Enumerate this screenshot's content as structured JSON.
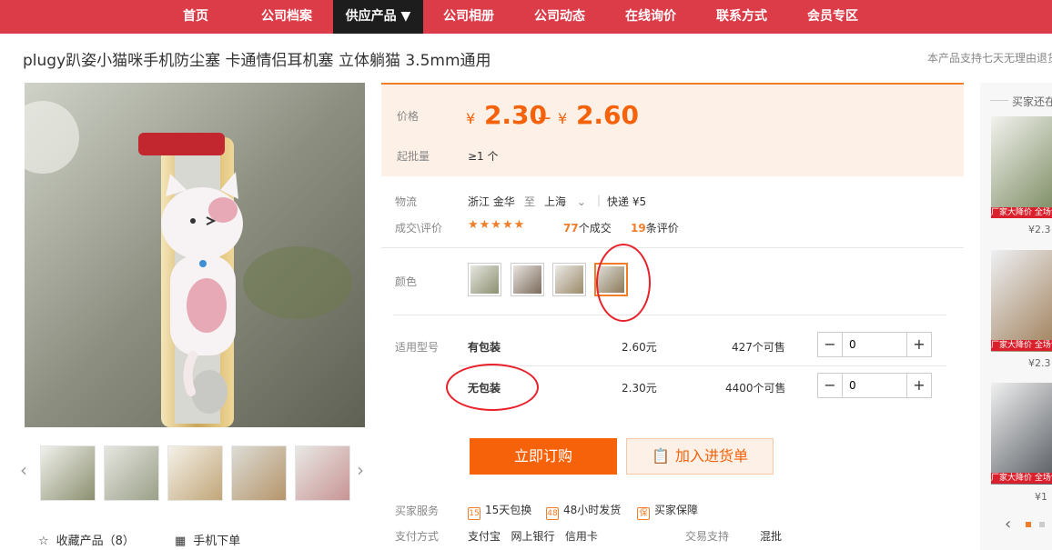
{
  "nav": {
    "items": [
      {
        "label": "首页"
      },
      {
        "label": "公司档案"
      },
      {
        "label": "供应产品 ▼"
      },
      {
        "label": "公司相册"
      },
      {
        "label": "公司动态"
      },
      {
        "label": "在线询价"
      },
      {
        "label": "联系方式"
      },
      {
        "label": "会员专区"
      }
    ],
    "active_index": 2
  },
  "product": {
    "title": "plugy趴姿小猫咪手机防尘塞 卡通情侣耳机塞 立体躺猫 3.5mm通用",
    "return_notice": "本产品支持七天无理由退货"
  },
  "price": {
    "label": "价格",
    "currency": "¥",
    "low": "2.30",
    "separator": "--",
    "high": "2.60",
    "moq_label": "起批量",
    "moq_value": "≥1 个"
  },
  "logistics": {
    "label": "物流",
    "from": "浙江 金华",
    "to_word": "至",
    "to": "上海",
    "express": "快递 ¥5"
  },
  "rating": {
    "label": "成交\\评价",
    "stars": "★★★★★",
    "deals_count": "77",
    "deals_suffix": "个成交",
    "reviews_count": "19",
    "reviews_suffix": "条评价"
  },
  "color": {
    "label": "颜色",
    "selected_index": 3
  },
  "models": {
    "label": "适用型号",
    "rows": [
      {
        "name": "有包装",
        "price": "2.60元",
        "stock": "427个可售",
        "qty": "0"
      },
      {
        "name": "无包装",
        "price": "2.30元",
        "stock": "4400个可售",
        "qty": "0"
      }
    ]
  },
  "actions": {
    "buy": "立即订购",
    "cart": "加入进货单"
  },
  "services": {
    "label": "买家服务",
    "items": [
      "15天包换",
      "48小时发货",
      "买家保障"
    ],
    "icons": [
      "15",
      "48",
      "保"
    ]
  },
  "payment": {
    "label": "支付方式",
    "methods": "支付宝   网上银行   信用卡",
    "trade_label": "交易支持",
    "trade_value": "混批"
  },
  "sidebar": {
    "favorite": "收藏产品（8）",
    "mobile_order": "手机下单"
  },
  "right_panel": {
    "title": "买家还在看",
    "badge": "厂家大降价 全场包邮",
    "prices": [
      "¥2.3",
      "¥2.3",
      "¥1"
    ]
  },
  "colors": {
    "nav_bg": "#dc3b48",
    "accent": "#f5620a",
    "annotation": "#e8222b"
  }
}
